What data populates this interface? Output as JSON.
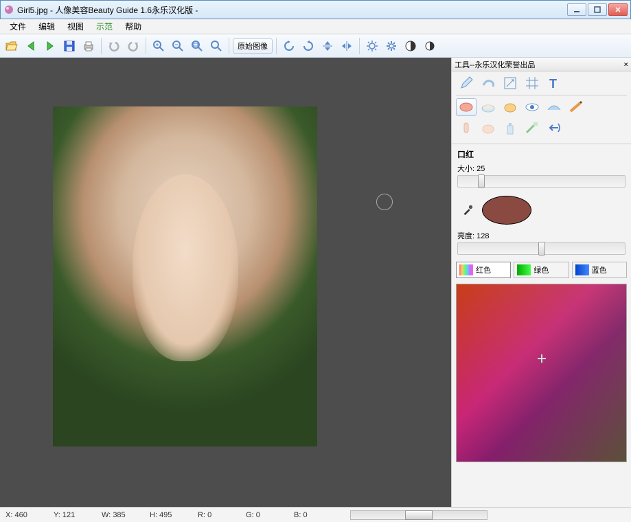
{
  "window": {
    "title": "Girl5.jpg - 人像美容Beauty Guide 1.6永乐汉化版 -"
  },
  "menu": {
    "file": "文件",
    "edit": "编辑",
    "view": "视图",
    "demo": "示范",
    "help": "帮助"
  },
  "toolbar": {
    "original": "原始图像"
  },
  "tools_panel": {
    "title": "工具--永乐汉化荣誉出品",
    "section": "口红",
    "size_label": "大小:",
    "size_value": "25",
    "brightness_label": "亮度:",
    "brightness_value": "128",
    "lip_color": "#8a4a42",
    "channels": {
      "red": "红色",
      "green": "绿色",
      "blue": "蓝色"
    }
  },
  "status": {
    "x_label": "X:",
    "x": "460",
    "y_label": "Y:",
    "y": "121",
    "w_label": "W:",
    "w": "385",
    "h_label": "H:",
    "h": "495",
    "r_label": "R:",
    "r": "0",
    "g_label": "G:",
    "g": "0",
    "b_label": "B:",
    "b": "0"
  },
  "canvas": {
    "brush_cursor_visible": true
  }
}
